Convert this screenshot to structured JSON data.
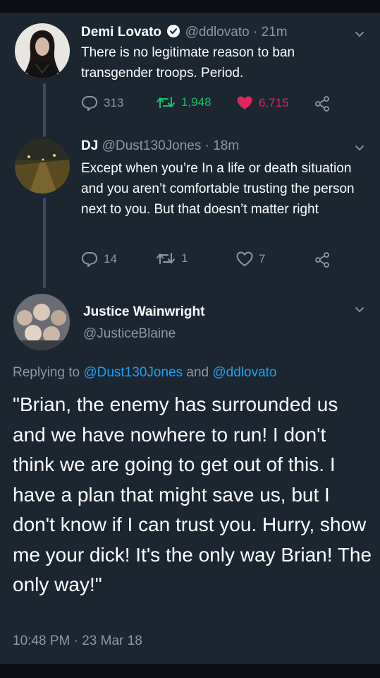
{
  "tweet1": {
    "name": "Demi Lovato",
    "handle": "@ddlovato · 21m",
    "text": "There is no legitimate reason to ban transgender troops. Period.",
    "replies": "313",
    "retweets": "1,948",
    "likes": "6,715",
    "verified": true
  },
  "tweet2": {
    "name": "DJ",
    "handle": "@Dust130Jones · 18m",
    "text": "Except when you’re In a life or death situation and you aren’t comfortable trusting the person next to you. But that doesn’t matter right",
    "replies": "14",
    "retweets": "1",
    "likes": "7"
  },
  "tweet3": {
    "name": "Justice Wainwright",
    "handle": "@JusticeBlaine",
    "replying_prefix": "Replying to ",
    "replying_user1": "@Dust130Jones",
    "replying_and": " and ",
    "replying_user2": "@ddlovato",
    "text": "\"Brian, the enemy has surrounded us and we have nowhere to run! I don't think we are going to get out of this. I have a plan that might save us, but I don't know if I can trust you. Hurry, show me your dick! It's the only way Brian! The only way!\"",
    "timestamp": "10:48 PM · 23 Mar 18"
  },
  "colors": {
    "background": "#1b2631",
    "secondary_text": "#8899a6",
    "link": "#1da1f2",
    "retweet_active": "#17bf63",
    "like_active": "#e0245e"
  },
  "icons": [
    "reply-icon",
    "retweet-icon",
    "heart-icon",
    "share-icon",
    "chevron-down-icon",
    "verified-icon"
  ]
}
